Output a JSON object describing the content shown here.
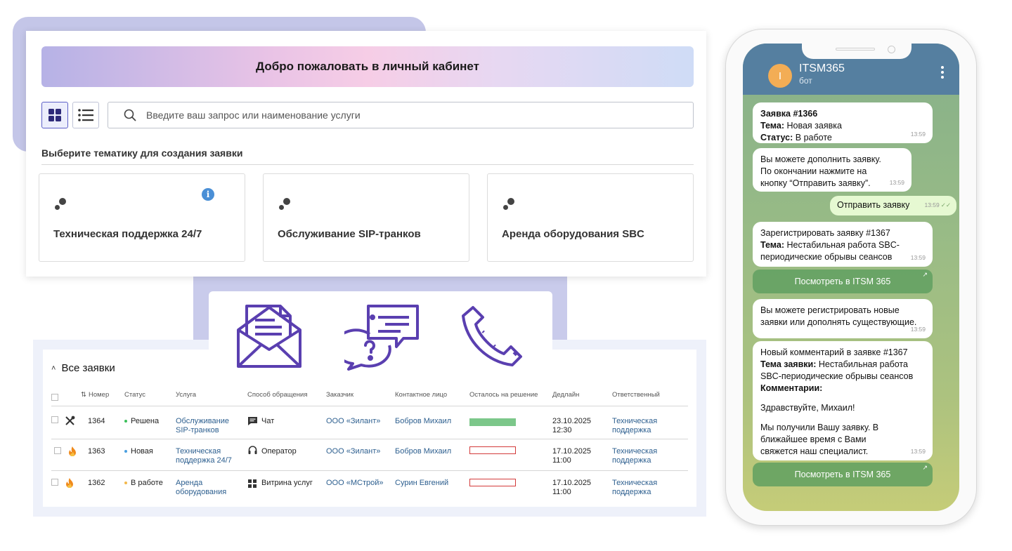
{
  "portal": {
    "welcome": "Добро пожаловать в личный кабинет",
    "search_placeholder": "Введите ваш запрос или наименование услуги",
    "topics_title": "Выберите тематику для создания заявки",
    "cards": [
      {
        "label": "Техническая поддержка 24/7",
        "info_icon": "i"
      },
      {
        "label": "Обслуживание SIP-транков"
      },
      {
        "label": "Аренда оборудования SBC"
      }
    ]
  },
  "channels": [
    "email-icon",
    "chat-icon",
    "phone-icon"
  ],
  "tickets": {
    "title": "Все заявки",
    "columns": [
      "Номер",
      "Статус",
      "Услуга",
      "Способ обращения",
      "Заказчик",
      "Контактное лицо",
      "Осталось на решение",
      "Дедлайн",
      "Ответственный"
    ],
    "rows": [
      {
        "number": "1364",
        "status": "Решена",
        "status_color": "#3bbf5a",
        "service": "Обслуживание SIP-транков",
        "channel": "Чат",
        "customer": "ООО «Зилант»",
        "contact": "Бобров Михаил",
        "remaining": 1.0,
        "deadline_date": "23.10.2025",
        "deadline_time": "12:30",
        "owner": "Техническая поддержка"
      },
      {
        "number": "1363",
        "status": "Новая",
        "status_color": "#4a9fe0",
        "service": "Техническая поддержка 24/7",
        "channel": "Оператор",
        "customer": "ООО «Зилант»",
        "contact": "Бобров Михаил",
        "remaining": 0.0,
        "deadline_date": "17.10.2025",
        "deadline_time": "11:00",
        "owner": "Техническая поддержка"
      },
      {
        "number": "1362",
        "status": "В работе",
        "status_color": "#f2b84b",
        "service": "Аренда оборудования",
        "channel": "Витрина услуг",
        "customer": "ООО «МСтрой»",
        "contact": "Сурин Евгений",
        "remaining": 0.0,
        "deadline_date": "17.10.2025",
        "deadline_time": "11:00",
        "owner": "Техническая поддержка"
      }
    ]
  },
  "chat": {
    "bot_name": "ITSM365",
    "bot_sub": "бот",
    "avatar_letter": "I",
    "m1": {
      "l1_b": "Заявка #1366",
      "l2_b": "Тема:",
      "l2": " Новая заявка",
      "l3_b": "Статус:",
      "l3": " В работе",
      "time": "13:59"
    },
    "m2": {
      "l1": "Вы можете дополнить заявку.",
      "l2": "По окончании нажмите на",
      "l3": "кнопку “Отправить заявку”.",
      "time": "13:59"
    },
    "m3": {
      "text": "Отправить заявку",
      "time": "13:59"
    },
    "m4": {
      "l1": "Зарегистрировать заявку #1367",
      "l2_b": "Тема:",
      "l2": " Нестабильная работа SBC-",
      "l3": "периодические обрывы сеансов",
      "time": "13:59"
    },
    "btn1": "Посмотреть в ITSM 365",
    "m5": {
      "l1": "Вы можете регистрировать новые",
      "l2": "заявки или дополнять существующие.",
      "time": "13:59"
    },
    "m6": {
      "l1": "Новый комментарий в заявке #1367",
      "l2_b": "Тема заявки:",
      "l2": " Нестабильная работа",
      "l3": "SBC-периодические обрывы сеансов",
      "l4": "Комментарии:",
      "l5": "Здравствуйте, Михаил!",
      "l6": "Мы получили Вашу заявку. В",
      "l7": "ближайшее время с Вами",
      "l8": "свяжется наш специалист.",
      "time": "13:59"
    },
    "btn2": "Посмотреть в ITSM 365"
  }
}
